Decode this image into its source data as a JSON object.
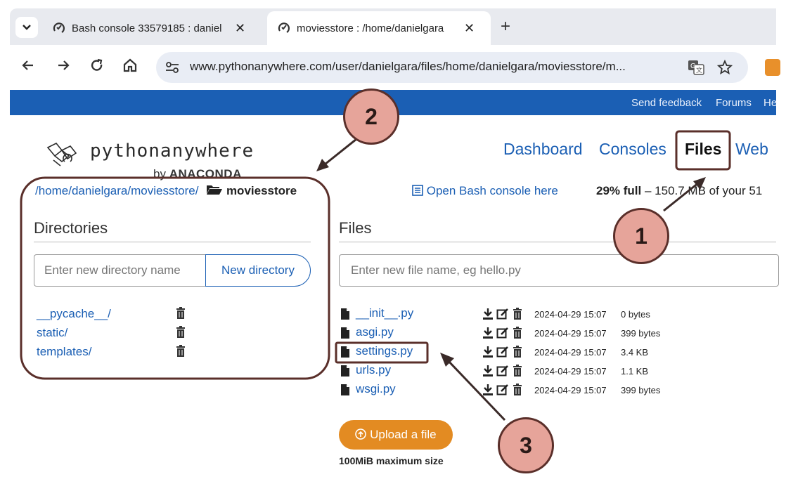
{
  "browser": {
    "tabs": [
      {
        "title": "Bash console 33579185 : daniel"
      },
      {
        "title": "moviesstore : /home/danielgara"
      }
    ],
    "url": "www.pythonanywhere.com/user/danielgara/files/home/danielgara/moviesstore/m..."
  },
  "topbar": {
    "send_feedback": "Send feedback",
    "forums": "Forums",
    "help": "He"
  },
  "logo": {
    "text": "pythonanywhere",
    "by": "by",
    "brand": "ANACONDA"
  },
  "nav": {
    "dashboard": "Dashboard",
    "consoles": "Consoles",
    "files": "Files",
    "web": "Web"
  },
  "breadcrumb": {
    "path": "/home/danielgara/moviesstore/",
    "current": "moviesstore"
  },
  "open_bash": "Open Bash console here",
  "quota": {
    "percent": "29% full",
    "rest": "– 150.7 MB of your 51"
  },
  "directories": {
    "heading": "Directories",
    "placeholder": "Enter new directory name",
    "button": "New directory",
    "items": [
      "__pycache__/",
      "static/",
      "templates/"
    ]
  },
  "files": {
    "heading": "Files",
    "placeholder": "Enter new file name, eg hello.py",
    "items": [
      {
        "name": "__init__.py",
        "date": "2024-04-29 15:07",
        "size": "0 bytes"
      },
      {
        "name": "asgi.py",
        "date": "2024-04-29 15:07",
        "size": "399 bytes"
      },
      {
        "name": "settings.py",
        "date": "2024-04-29 15:07",
        "size": "3.4 KB"
      },
      {
        "name": "urls.py",
        "date": "2024-04-29 15:07",
        "size": "1.1 KB"
      },
      {
        "name": "wsgi.py",
        "date": "2024-04-29 15:07",
        "size": "399 bytes"
      }
    ],
    "upload": "Upload a file",
    "upload_note": "100MiB maximum size"
  },
  "annotations": [
    "1",
    "2",
    "3"
  ],
  "colors": {
    "brand_blue": "#1b5fb4",
    "upload_orange": "#e38b22",
    "callout_fill": "#e6a49a",
    "callout_stroke": "#5a2f2a"
  }
}
